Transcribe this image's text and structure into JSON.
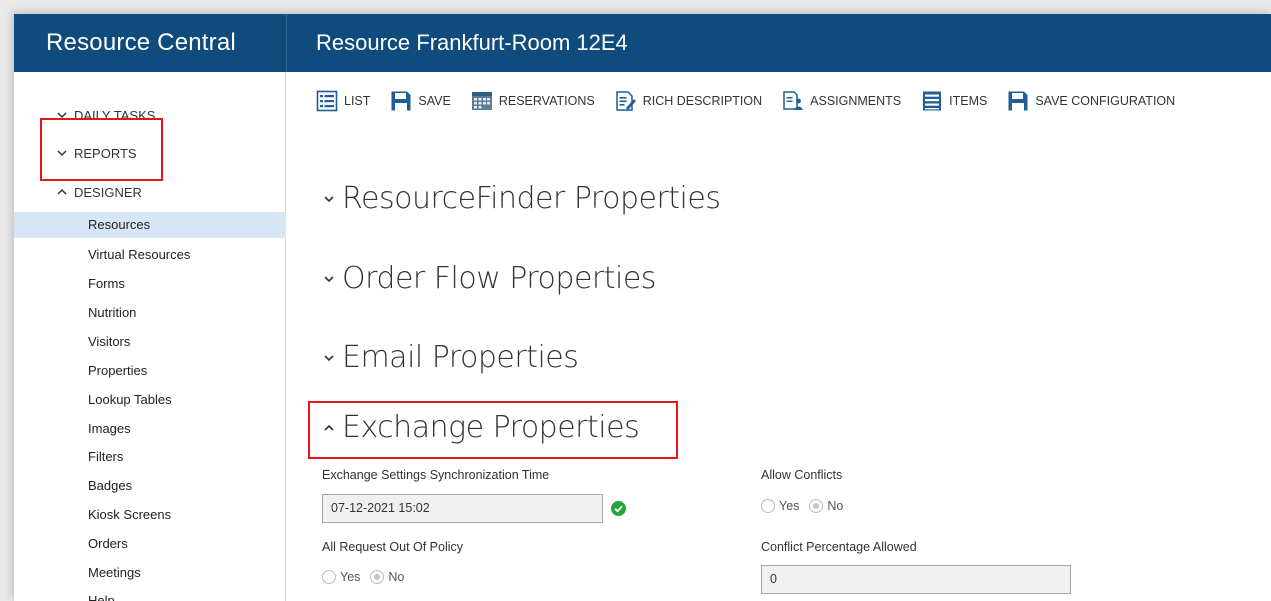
{
  "app": {
    "brand": "Resource Central",
    "page_title": "Resource Frankfurt-Room 12E4"
  },
  "sidebar": {
    "sections": [
      {
        "label": "DAILY TASKS",
        "expanded": false
      },
      {
        "label": "REPORTS",
        "expanded": false
      },
      {
        "label": "DESIGNER",
        "expanded": true
      }
    ],
    "designer_items": [
      {
        "label": "Resources",
        "active": true
      },
      {
        "label": "Virtual Resources"
      },
      {
        "label": "Forms"
      },
      {
        "label": "Nutrition"
      },
      {
        "label": "Visitors"
      },
      {
        "label": "Properties"
      },
      {
        "label": "Lookup Tables"
      },
      {
        "label": "Images"
      },
      {
        "label": "Filters"
      },
      {
        "label": "Badges"
      },
      {
        "label": "Kiosk Screens"
      },
      {
        "label": "Orders"
      },
      {
        "label": "Meetings"
      },
      {
        "label": "Help"
      }
    ]
  },
  "toolbar": {
    "list": "LIST",
    "save": "SAVE",
    "reservations": "RESERVATIONS",
    "rich_description": "RICH DESCRIPTION",
    "assignments": "ASSIGNMENTS",
    "items": "ITEMS",
    "save_configuration": "SAVE CONFIGURATION"
  },
  "sections": {
    "resourcefinder": "ResourceFinder Properties",
    "order_flow": "Order Flow Properties",
    "email": "Email Properties",
    "exchange": "Exchange Properties"
  },
  "exchange": {
    "sync_time_label": "Exchange Settings Synchronization Time",
    "sync_time_value": "07-12-2021 15:02",
    "allow_conflicts_label": "Allow Conflicts",
    "all_request_label": "All Request Out Of Policy",
    "conflict_pct_label": "Conflict Percentage Allowed",
    "conflict_pct_value": "0",
    "yes": "Yes",
    "no": "No",
    "allow_conflicts_selected": "No",
    "all_request_selected": "No"
  },
  "colors": {
    "header_bg": "#0f4c7d",
    "active_bg": "#d6e6f5",
    "highlight": "#e8141c",
    "ok": "#22a63a"
  }
}
